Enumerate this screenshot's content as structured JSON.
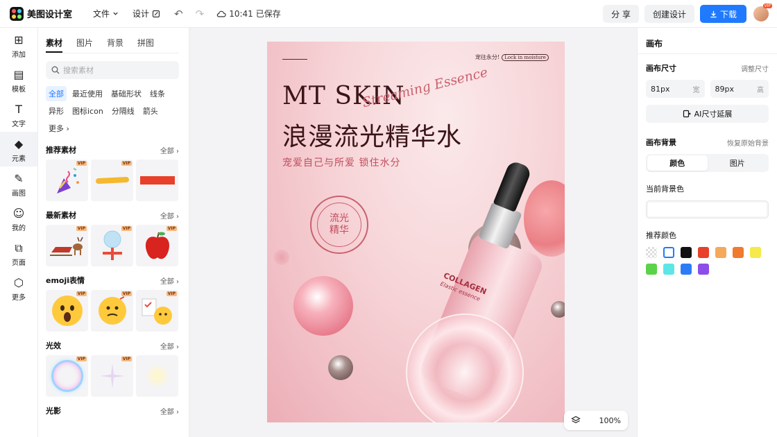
{
  "app": {
    "name": "美图设计室"
  },
  "header": {
    "menu_file": "文件",
    "menu_design": "设计",
    "save_time": "10:41",
    "save_status": "已保存",
    "share_label": "分 享",
    "create_label": "创建设计",
    "download_label": "下载",
    "avatar_badge": "VIP"
  },
  "rail": {
    "items": [
      {
        "label": "添加"
      },
      {
        "label": "模板"
      },
      {
        "label": "文字"
      },
      {
        "label": "元素"
      },
      {
        "label": "画图"
      },
      {
        "label": "我的"
      },
      {
        "label": "页面"
      },
      {
        "label": "更多"
      }
    ]
  },
  "panel": {
    "tabs": [
      "素材",
      "图片",
      "背景",
      "拼图"
    ],
    "search_placeholder": "搜索素材",
    "chips": [
      "全部",
      "最近使用",
      "基础形状",
      "线条",
      "异形",
      "图标icon",
      "分隔线",
      "箭头",
      "更多"
    ],
    "all_label": "全部",
    "vip_label": "VIP",
    "sections": [
      {
        "title": "推荐素材"
      },
      {
        "title": "最新素材"
      },
      {
        "title": "emoji表情"
      },
      {
        "title": "光效"
      },
      {
        "title": "光影"
      }
    ]
  },
  "canvas": {
    "poster": {
      "top_right_text": "宠往永分!",
      "top_right_pill": "Lock in moisture",
      "title_en": "MT SKIN",
      "script": "Streaming Essence",
      "title_cn": "浪漫流光精华水",
      "subtitle": "宠爱自己与所爱 锁住水分",
      "seal_text_1": "流光",
      "seal_text_2": "精华",
      "bottle_brand": "COLLAGEN",
      "bottle_sub": "Elastic essence"
    },
    "zoom": "100%"
  },
  "right_panel": {
    "title": "画布",
    "size_label": "画布尺寸",
    "size_link": "调整尺寸",
    "width_value": "81px",
    "width_unit": "宽",
    "height_value": "89px",
    "height_unit": "高",
    "ai_extend": "AI尺寸延展",
    "bg_label": "画布背景",
    "bg_link": "恢复原始背景",
    "seg_color": "颜色",
    "seg_image": "图片",
    "current_bg_label": "当前背景色",
    "recommend_label": "推荐颜色",
    "swatches": [
      "transparent",
      "#ffffff",
      "#111111",
      "#e8402a",
      "#f5a95b",
      "#f07a2e",
      "#f5ea4a",
      "#5bd24a",
      "#5de6e6",
      "#2d7cf6",
      "#8b4ee8"
    ]
  },
  "colors": {
    "accent": "#1f7aff"
  }
}
